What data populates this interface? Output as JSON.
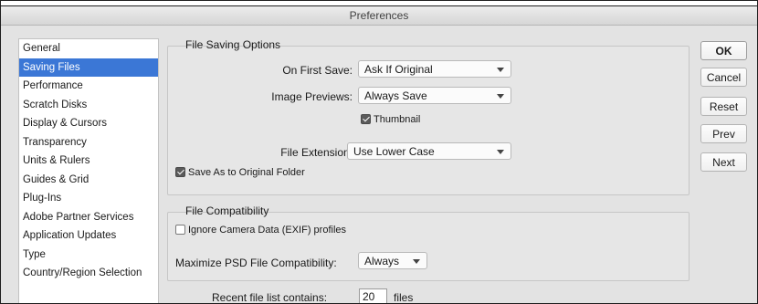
{
  "window": {
    "title": "Preferences"
  },
  "sidebar": {
    "items": [
      {
        "label": "General",
        "selected": false
      },
      {
        "label": "Saving Files",
        "selected": true
      },
      {
        "label": "Performance",
        "selected": false
      },
      {
        "label": "Scratch Disks",
        "selected": false
      },
      {
        "label": "Display & Cursors",
        "selected": false
      },
      {
        "label": "Transparency",
        "selected": false
      },
      {
        "label": "Units & Rulers",
        "selected": false
      },
      {
        "label": "Guides & Grid",
        "selected": false
      },
      {
        "label": "Plug-Ins",
        "selected": false
      },
      {
        "label": "Adobe Partner Services",
        "selected": false
      },
      {
        "label": "Application Updates",
        "selected": false
      },
      {
        "label": "Type",
        "selected": false
      },
      {
        "label": "Country/Region Selection",
        "selected": false
      }
    ]
  },
  "file_saving": {
    "title": "File Saving Options",
    "on_first_save": {
      "label": "On First Save:",
      "value": "Ask If Original"
    },
    "image_previews": {
      "label": "Image Previews:",
      "value": "Always Save"
    },
    "thumbnail": {
      "label": "Thumbnail",
      "checked": true
    },
    "file_extension": {
      "label": "File Extension:",
      "value": "Use Lower Case"
    },
    "save_as_original": {
      "label": "Save As to Original Folder",
      "checked": true
    }
  },
  "file_compat": {
    "title": "File Compatibility",
    "ignore_camera": {
      "label": "Ignore Camera Data (EXIF) profiles",
      "checked": false
    },
    "maximize_psd": {
      "label": "Maximize PSD File Compatibility:",
      "value": "Always"
    }
  },
  "recent_files": {
    "label": "Recent file list contains:",
    "value": "20",
    "suffix": "files"
  },
  "buttons": {
    "ok": "OK",
    "cancel": "Cancel",
    "reset": "Reset",
    "prev": "Prev",
    "next": "Next"
  },
  "colors": {
    "selection": "#3b77d6",
    "panel": "#e3e3e3"
  }
}
